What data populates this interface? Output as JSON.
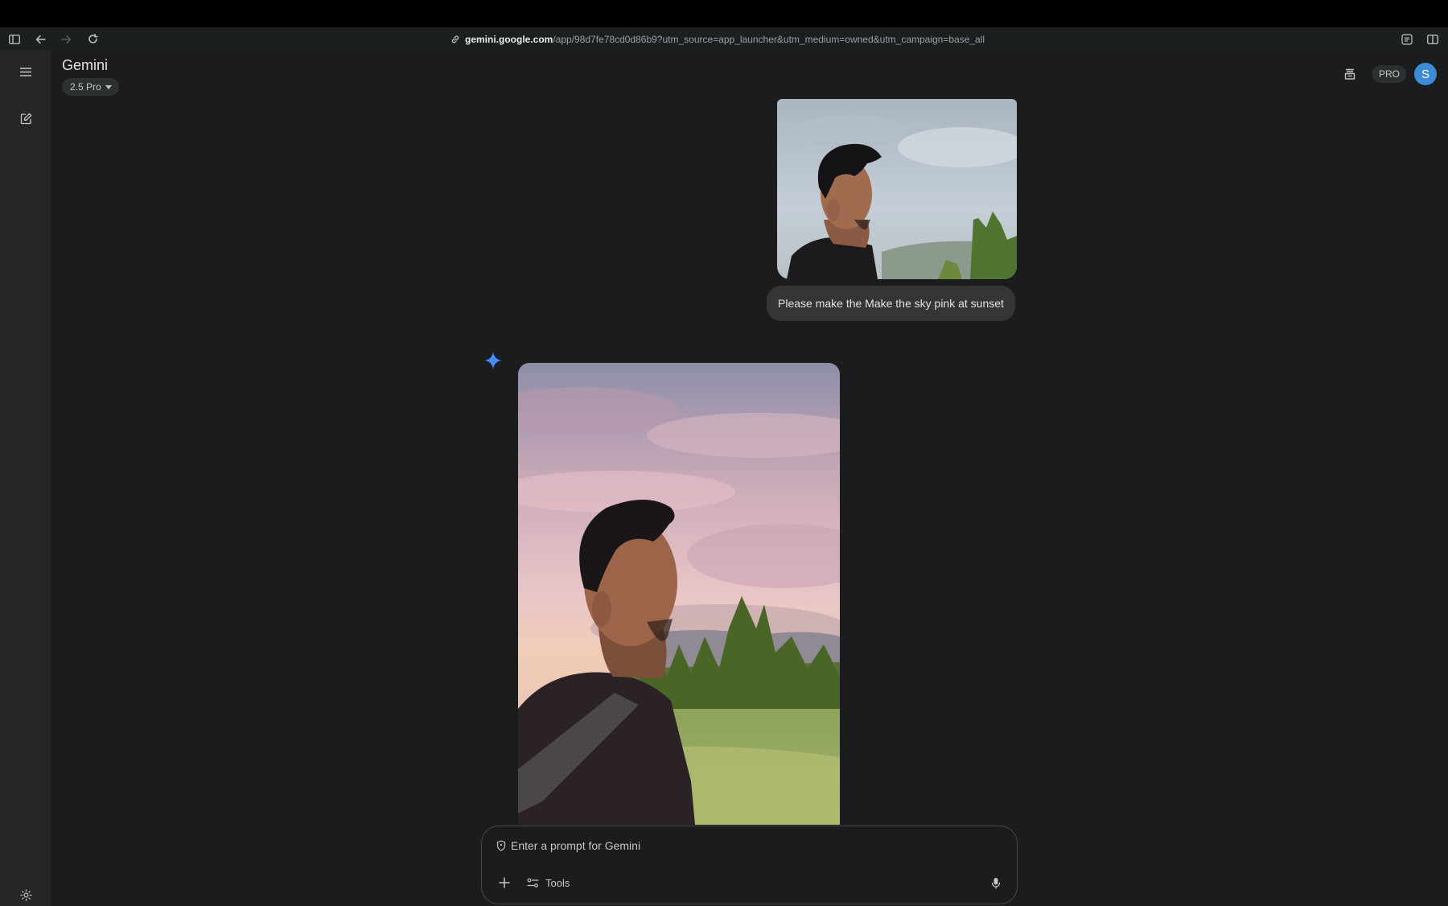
{
  "browser": {
    "url_host": "gemini.google.com",
    "url_path": "/app/98d7fe78cd0d86b9?utm_source=app_launcher&utm_medium=owned&utm_campaign=base_all"
  },
  "header": {
    "title": "Gemini",
    "model": "2.5 Pro",
    "pro_badge": "PRO",
    "avatar_initial": "S"
  },
  "conversation": {
    "user_message": "Please make the Make the sky pink at sunset"
  },
  "composer": {
    "placeholder": "Enter a prompt for Gemini",
    "tools_label": "Tools"
  },
  "colors": {
    "background": "#1b1c1d",
    "rail": "#242628",
    "accent": "#3d8ad8",
    "spark": "#4a8af4"
  }
}
